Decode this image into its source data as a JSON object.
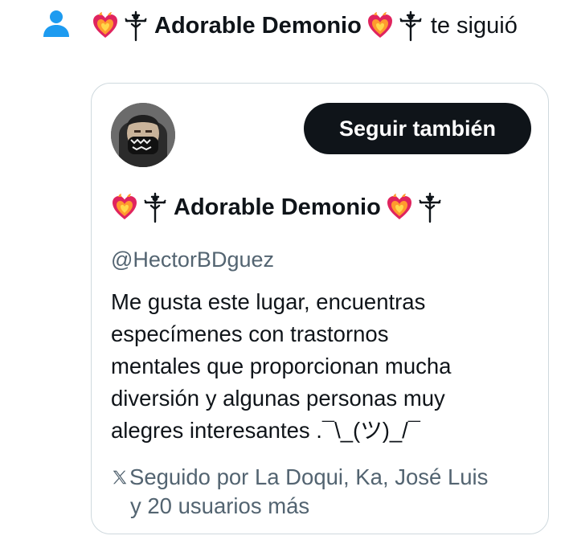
{
  "notification": {
    "icon": "person-icon",
    "display_name": "Adorable Demonio",
    "action_text": "te siguió",
    "emoji_icons": [
      "heart-on-fire-icon",
      "scarecrow-icon"
    ]
  },
  "profile_card": {
    "display_name": "Adorable Demonio",
    "follow_button_label": "Seguir también",
    "handle": "@HectorBDguez",
    "bio": "Me gusta este lugar,  encuentras\nespecímenes con trastornos\nmentales que proporcionan mucha\ndiversión y algunas personas muy\nalegres interesantes .¯\\_(ツ)_/¯",
    "followed_by_line1": "Seguido por La Doqui, Ka, José Luis",
    "followed_by_line2": "y 20 usuarios más"
  },
  "colors": {
    "accent": "#1d9bf0",
    "text_primary": "#0f1419",
    "text_secondary": "#536471",
    "border": "#cfd9de",
    "button_bg": "#0f1419"
  }
}
